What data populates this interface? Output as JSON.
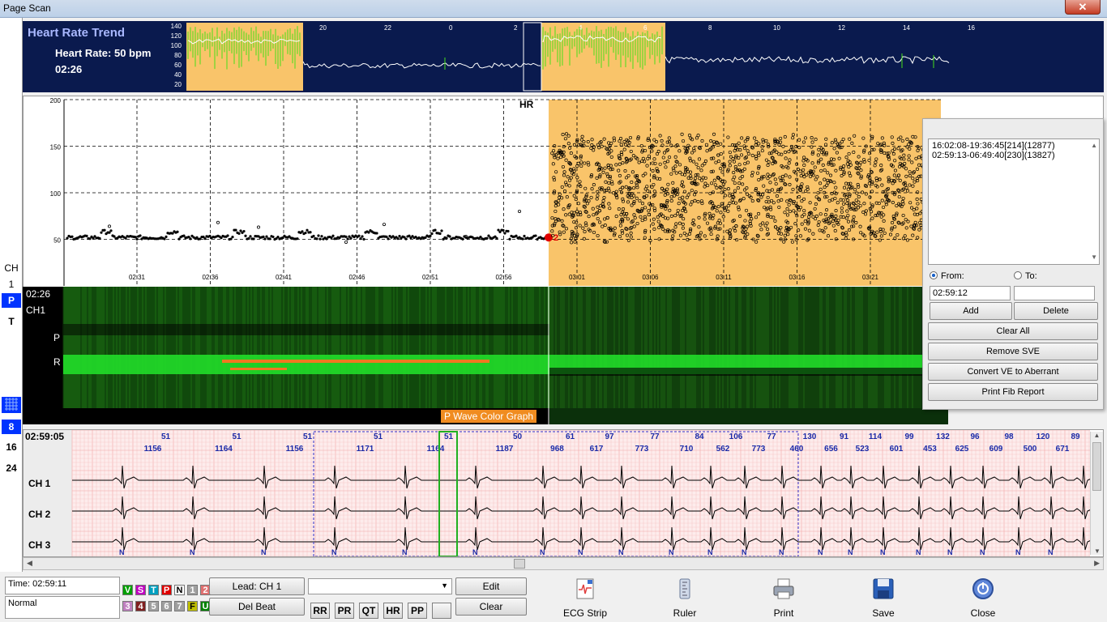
{
  "window": {
    "title": "Page Scan",
    "close_glyph": "✕"
  },
  "left_strip": {
    "ch_label": "CH",
    "ch_num": "1",
    "p_tag": "P",
    "t_tag": "T",
    "grid_icon": "grid-icon",
    "spans": [
      "8",
      "16",
      "24"
    ]
  },
  "trend": {
    "title": "Heart Rate Trend",
    "heart_rate": "Heart Rate: 50 bpm",
    "time": "02:26",
    "y_ticks": [
      "140",
      "120",
      "100",
      "80",
      "60",
      "40",
      "20"
    ],
    "x_ticks": [
      "20",
      "22",
      "0",
      "2",
      "4",
      "6",
      "8",
      "10",
      "12",
      "14",
      "16"
    ]
  },
  "hr_chart": {
    "label": "HR",
    "y_ticks": [
      "200",
      "150",
      "100",
      "50"
    ],
    "x_ticks": [
      "02:31",
      "02:36",
      "02:41",
      "02:46",
      "02:51",
      "02:56",
      "03:01",
      "03:06",
      "03:11",
      "03:16",
      "03:21"
    ],
    "marker_label": "2"
  },
  "p_wave": {
    "time": "02:26",
    "channel": "CH1",
    "p_label": "P",
    "r_label": "R",
    "button": "P Wave Color Graph"
  },
  "fib_panel": {
    "episodes": [
      "16:02:08-19:36:45[214](12877)",
      "02:59:13-06:49:40[230](13827)"
    ],
    "from_label": "From:",
    "to_label": "To:",
    "from_value": "02:59:12",
    "to_value": "",
    "buttons": {
      "add": "Add",
      "delete": "Delete",
      "clear_all": "Clear All",
      "remove_sve": "Remove SVE",
      "convert": "Convert VE to Aberrant",
      "print_fib": "Print Fib Report"
    }
  },
  "ecg": {
    "time": "02:59:05",
    "hr_values": [
      "51",
      "51",
      "51",
      "51",
      "51",
      "50",
      "61",
      "97",
      "77",
      "84",
      "106",
      "77",
      "130",
      "91",
      "114",
      "99",
      "132",
      "96",
      "98",
      "120",
      "89"
    ],
    "rr_values": [
      "1156",
      "1164",
      "1156",
      "1171",
      "1164",
      "1187",
      "968",
      "617",
      "773",
      "710",
      "562",
      "773",
      "460",
      "656",
      "523",
      "601",
      "453",
      "625",
      "609",
      "500",
      "671"
    ],
    "channels": [
      "CH 1",
      "CH 2",
      "CH 3"
    ],
    "beat_label": "N"
  },
  "bottom": {
    "time": "Time: 02:59:11",
    "rhythm": "Normal",
    "tags_row1": [
      {
        "t": "V",
        "c": "#00a000"
      },
      {
        "t": "S",
        "c": "#c000c0"
      },
      {
        "t": "T",
        "c": "#00a0c0"
      },
      {
        "t": "P",
        "c": "#e00000"
      },
      {
        "t": "N",
        "c": "#ffffff"
      },
      {
        "t": "1",
        "c": "#a0a0a0"
      },
      {
        "t": "2",
        "c": "#e07070"
      }
    ],
    "tags_row2": [
      {
        "t": "3",
        "c": "#c080c0"
      },
      {
        "t": "4",
        "c": "#802020"
      },
      {
        "t": "5",
        "c": "#a0a0a0"
      },
      {
        "t": "6",
        "c": "#a0a0a0"
      },
      {
        "t": "7",
        "c": "#a0a0a0"
      },
      {
        "t": "F",
        "c": "#c0c000"
      },
      {
        "t": "U",
        "c": "#008000"
      }
    ],
    "lead_button": "Lead: CH 1",
    "del_beat": "Del Beat",
    "edit": "Edit",
    "clear": "Clear",
    "small_buttons": [
      "RR",
      "PR",
      "QT",
      "HR",
      "PP"
    ],
    "tools": [
      {
        "label": "ECG Strip",
        "icon": "ecg-strip-icon"
      },
      {
        "label": "Ruler",
        "icon": "ruler-icon"
      },
      {
        "label": "Print",
        "icon": "printer-icon"
      },
      {
        "label": "Save",
        "icon": "floppy-disk-icon"
      },
      {
        "label": "Close",
        "icon": "close-icon"
      }
    ]
  }
}
